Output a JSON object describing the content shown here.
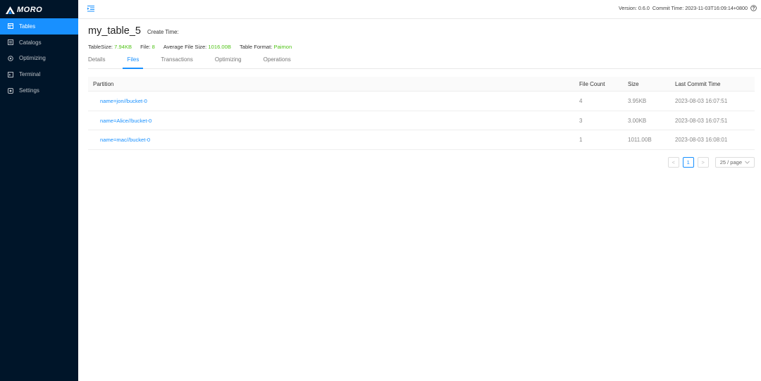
{
  "brand": {
    "name": "MORO"
  },
  "sidebar": {
    "items": [
      {
        "label": "Tables",
        "icon": "table-icon",
        "active": true
      },
      {
        "label": "Catalogs",
        "icon": "catalog-icon",
        "active": false
      },
      {
        "label": "Optimizing",
        "icon": "optimizing-icon",
        "active": false
      },
      {
        "label": "Terminal",
        "icon": "terminal-icon",
        "active": false
      },
      {
        "label": "Settings",
        "icon": "settings-icon",
        "active": false
      }
    ]
  },
  "header": {
    "version": "Version: 0.6.0",
    "commit_time": "Commit Time: 2023-11-03T16:09:14+0800"
  },
  "page": {
    "title": "my_table_5",
    "create_time_label": "Create Time:",
    "stats": [
      {
        "label": "TableSize:",
        "value": "7.94KB"
      },
      {
        "label": "File:",
        "value": "8"
      },
      {
        "label": "Average File Size:",
        "value": "1016.00B"
      },
      {
        "label": "Table Format:",
        "value": "Paimon"
      }
    ],
    "tabs": [
      {
        "label": "Details",
        "active": false
      },
      {
        "label": "Files",
        "active": true
      },
      {
        "label": "Transactions",
        "active": false
      },
      {
        "label": "Optimizing",
        "active": false
      },
      {
        "label": "Operations",
        "active": false
      }
    ]
  },
  "table": {
    "columns": [
      "Partition",
      "File Count",
      "Size",
      "Last Commit Time"
    ],
    "rows": [
      {
        "partition": "name=jon//bucket-0",
        "file_count": "4",
        "size": "3.95KB",
        "last_commit": "2023-08-03 16:07:51"
      },
      {
        "partition": "name=Alice//bucket-0",
        "file_count": "3",
        "size": "3.00KB",
        "last_commit": "2023-08-03 16:07:51"
      },
      {
        "partition": "name=mac//bucket-0",
        "file_count": "1",
        "size": "1011.00B",
        "last_commit": "2023-08-03 16:08:01"
      }
    ]
  },
  "pagination": {
    "prev": "<",
    "current": "1",
    "next": ">",
    "page_size": "25 / page"
  },
  "colors": {
    "accent": "#1890ff",
    "sidebar_bg": "#001529",
    "stat_value": "#52c41a"
  }
}
